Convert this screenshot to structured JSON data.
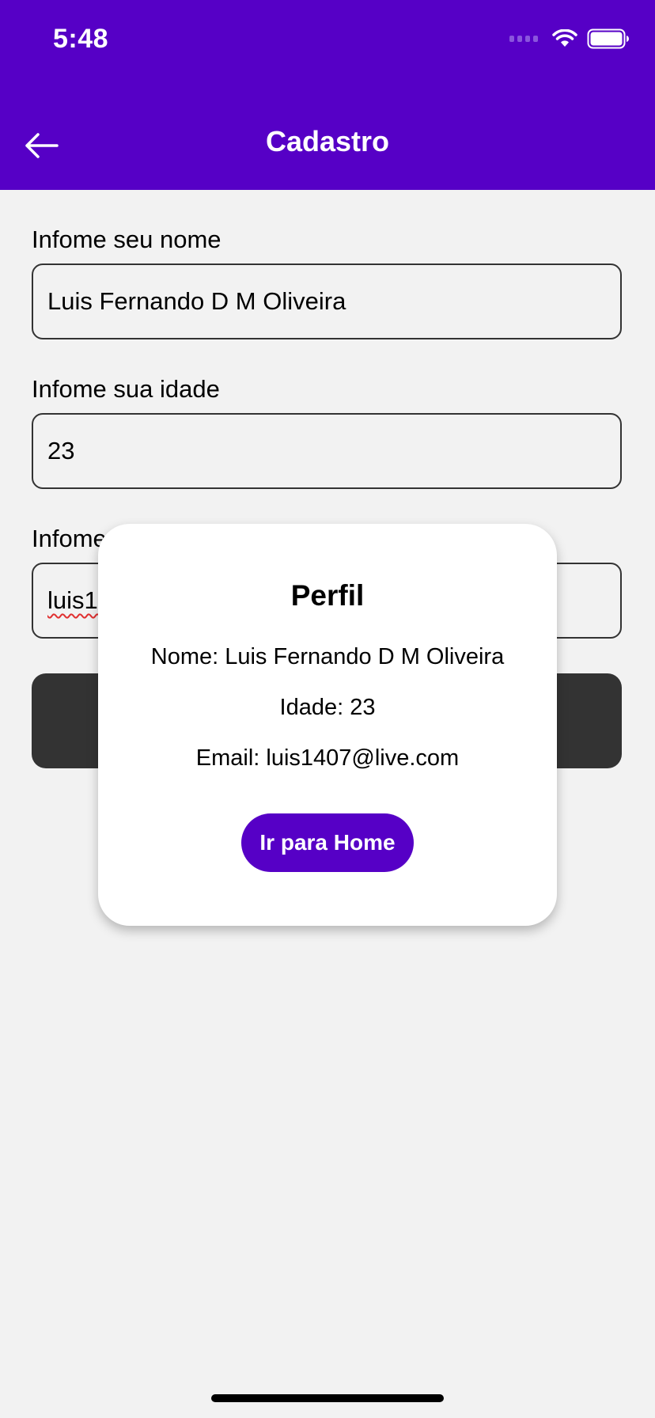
{
  "status_bar": {
    "time": "5:48",
    "icons": [
      "signal-icon",
      "wifi-icon",
      "battery-icon"
    ]
  },
  "nav": {
    "title": "Cadastro",
    "back_icon": "arrow-left-icon"
  },
  "form": {
    "name_label": "Infome seu nome",
    "name_value": "Luis Fernando D M Oliveira",
    "age_label": "Infome sua idade",
    "age_value": "23",
    "email_label_visible": "Infome",
    "email_value_visible": "luis14"
  },
  "modal": {
    "title": "Perfil",
    "name_line": "Nome: Luis Fernando D M Oliveira",
    "age_line": "Idade: 23",
    "email_line": "Email: luis1407@live.com",
    "button_label": "Ir para Home"
  },
  "colors": {
    "primary": "#5600c6",
    "background": "#f2f2f2",
    "submit_button": "#333333"
  }
}
